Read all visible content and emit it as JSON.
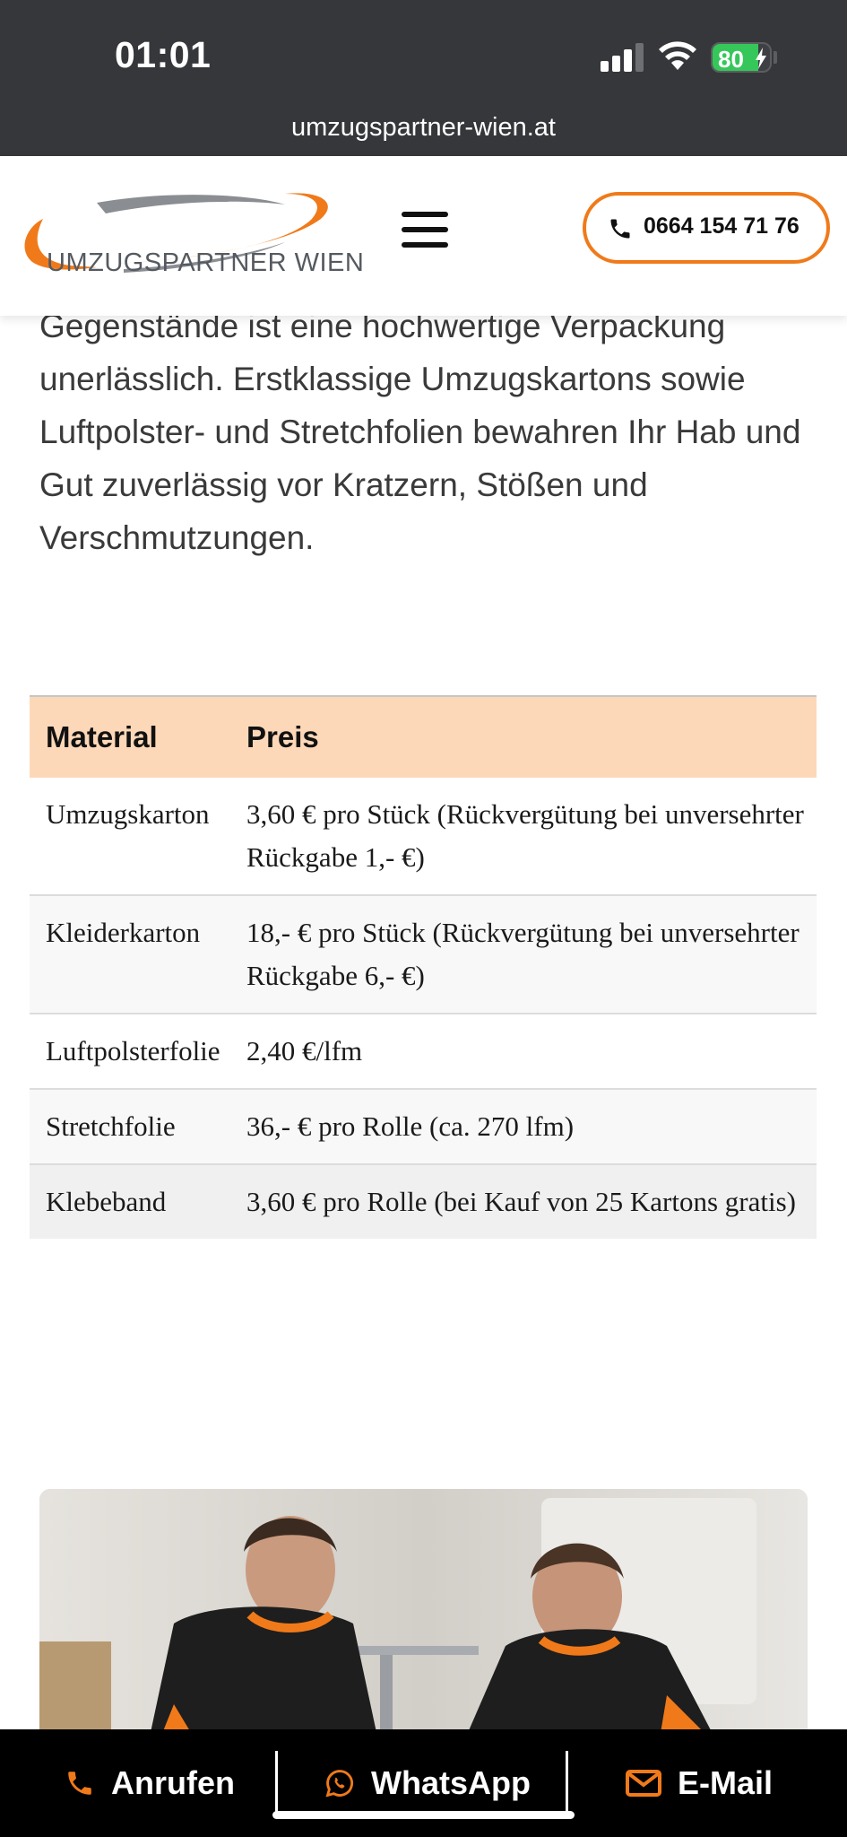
{
  "status_bar": {
    "time": "01:01",
    "battery_level": 80,
    "battery_text": "80",
    "signal_bars_active": 3,
    "signal_bars_total": 4
  },
  "browser": {
    "url": "umzugspartner-wien.at"
  },
  "header": {
    "logo_text": "UMZUGSPARTNER WIEN",
    "menu_icon": "hamburger-icon",
    "phone_icon": "phone-icon",
    "phone_label": "0664 154 71 76"
  },
  "intro_text": "Gegenstände ist eine hochwertige Verpackung unerlässlich. Erstklassige Umzugskartons sowie Luftpolster- und Stretchfolien bewahren Ihr Hab und Gut zuverlässig vor Kratzern, Stößen und Verschmutzungen.",
  "price_table": {
    "headers": [
      "Material",
      "Preis"
    ],
    "rows": [
      [
        "Umzugskarton",
        "3,60 € pro Stück (Rückvergütung bei unversehrter Rückgabe 1,- €)"
      ],
      [
        "Kleiderkarton",
        "18,- € pro Stück (Rückvergütung bei unversehrter Rückgabe 6,- €)"
      ],
      [
        "Luftpolsterfolie",
        "2,40 €/lfm"
      ],
      [
        "Stretchfolie",
        "36,- € pro Rolle (ca. 270 lfm)"
      ],
      [
        "Klebeband",
        "3,60 € pro Rolle (bei Kauf von 25 Kartons gratis)"
      ]
    ]
  },
  "bottom_bar": {
    "call_label": "Anrufen",
    "whatsapp_label": "WhatsApp",
    "email_label": "E-Mail"
  },
  "colors": {
    "accent": "#f07a1a",
    "table_header_bg": "#fdd8b8",
    "status_bar_bg": "#35373a",
    "battery_green": "#35c759"
  }
}
